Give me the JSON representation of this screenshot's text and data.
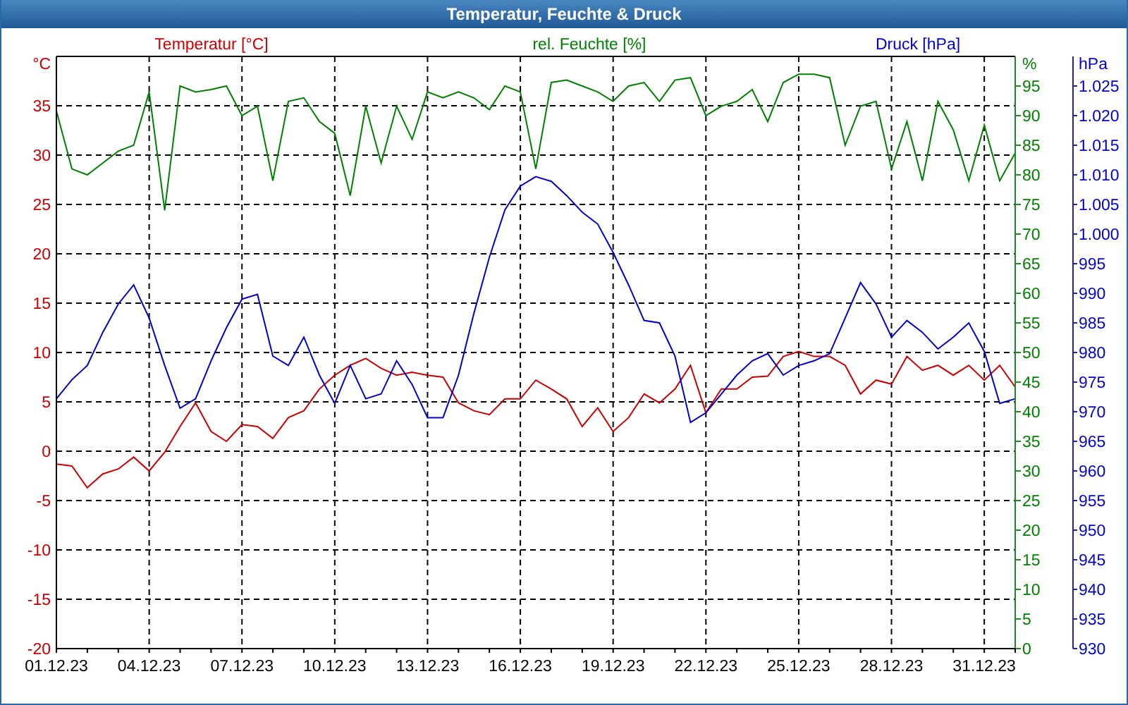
{
  "window": {
    "title": "Temperatur, Feuchte & Druck"
  },
  "chart_data": {
    "type": "line",
    "grid": true,
    "ylim": [
      -20,
      40
    ],
    "y2lim": [
      0,
      100
    ],
    "y3lim": [
      930,
      1030
    ],
    "ylabel": "°C",
    "y2label": "%",
    "y3label": "hPa",
    "yticks": [
      -20,
      -15,
      -10,
      -5,
      0,
      5,
      10,
      15,
      20,
      25,
      30,
      35
    ],
    "y2ticks": [
      0,
      5,
      10,
      15,
      20,
      25,
      30,
      35,
      40,
      45,
      50,
      55,
      60,
      65,
      70,
      75,
      80,
      85,
      90,
      95
    ],
    "y3ticks": [
      930,
      935,
      940,
      945,
      950,
      955,
      960,
      965,
      970,
      975,
      980,
      985,
      990,
      995,
      {
        "value": 1000,
        "label": "1.000"
      },
      {
        "value": 1005,
        "label": "1.005"
      },
      {
        "value": 1010,
        "label": "1.010"
      },
      {
        "value": 1015,
        "label": "1.015"
      },
      {
        "value": 1020,
        "label": "1.020"
      },
      {
        "value": 1025,
        "label": "1.025"
      }
    ],
    "categories": [
      "01.12.23",
      null,
      null,
      null,
      null,
      null,
      "04.12.23",
      null,
      null,
      null,
      null,
      null,
      "07.12.23",
      null,
      null,
      null,
      null,
      null,
      "10.12.23",
      null,
      null,
      null,
      null,
      null,
      "13.12.23",
      null,
      null,
      null,
      null,
      null,
      "16.12.23",
      null,
      null,
      null,
      null,
      null,
      "19.12.23",
      null,
      null,
      null,
      null,
      null,
      "22.12.23",
      null,
      null,
      null,
      null,
      null,
      "25.12.23",
      null,
      null,
      null,
      null,
      null,
      "28.12.23",
      null,
      null,
      null,
      null,
      null,
      "31.12.23",
      null,
      null
    ],
    "series": [
      {
        "name": "Temperatur [°C]",
        "color": "#cc0000",
        "axis": "y",
        "values": [
          -1.3,
          -1.5,
          -3.7,
          -2.3,
          -1.8,
          -0.6,
          -2.0,
          -0.1,
          2.5,
          4.9,
          2.0,
          1.0,
          2.7,
          2.5,
          1.3,
          3.4,
          4.1,
          6.3,
          7.7,
          8.7,
          9.4,
          8.4,
          7.7,
          8.0,
          7.7,
          7.5,
          4.9,
          4.1,
          3.7,
          5.3,
          5.3,
          7.2,
          6.3,
          5.3,
          2.5,
          4.4,
          2.0,
          3.4,
          5.8,
          4.9,
          6.3,
          8.7,
          3.9,
          6.3,
          6.3,
          7.5,
          7.6,
          9.6,
          10.1,
          9.6,
          9.6,
          8.7,
          5.8,
          7.2,
          6.8,
          9.6,
          8.2,
          8.7,
          7.7,
          8.7,
          7.2,
          8.7,
          6.5
        ]
      },
      {
        "name": "rel. Feuchte [%]",
        "color": "#008000",
        "axis": "y2",
        "values": [
          90.8,
          81,
          80,
          82,
          84,
          85,
          94,
          74,
          95,
          94,
          94.4,
          95,
          90,
          91.6,
          79,
          92.4,
          93,
          89,
          87,
          76.5,
          91.6,
          82,
          91.6,
          86,
          94,
          93,
          94,
          93,
          91,
          95,
          94,
          81,
          95.6,
          96,
          95,
          94,
          92.4,
          95,
          95.6,
          92.4,
          96,
          96.4,
          90,
          91.6,
          92.4,
          94.4,
          89,
          95.6,
          97,
          97,
          96.4,
          85,
          91.6,
          92.4,
          81,
          89,
          79,
          92.4,
          87.6,
          79,
          88.4,
          79,
          83.7
        ]
      },
      {
        "name": "Druck [hPa]",
        "color": "#0000cc",
        "axis": "y3",
        "values": [
          972.2,
          975.4,
          977.8,
          983.4,
          988.2,
          991.4,
          985.8,
          977.8,
          970.6,
          972.2,
          978.6,
          984.2,
          989,
          989.8,
          979.4,
          977.8,
          982.6,
          976.2,
          971.4,
          977.8,
          972.2,
          973,
          978.6,
          974.6,
          969,
          969,
          976.2,
          986.6,
          996.1,
          1004.1,
          1008.1,
          1009.7,
          1008.9,
          1006.5,
          1003.7,
          1001.7,
          996.9,
          991.4,
          985.4,
          985,
          979.4,
          968.2,
          969.8,
          973,
          976.2,
          978.6,
          979.8,
          976.2,
          977.8,
          978.6,
          979.8,
          985.8,
          991.8,
          988.2,
          982.6,
          985.4,
          983.4,
          980.6,
          982.6,
          985,
          980.2,
          971.4,
          972.2
        ]
      }
    ]
  }
}
